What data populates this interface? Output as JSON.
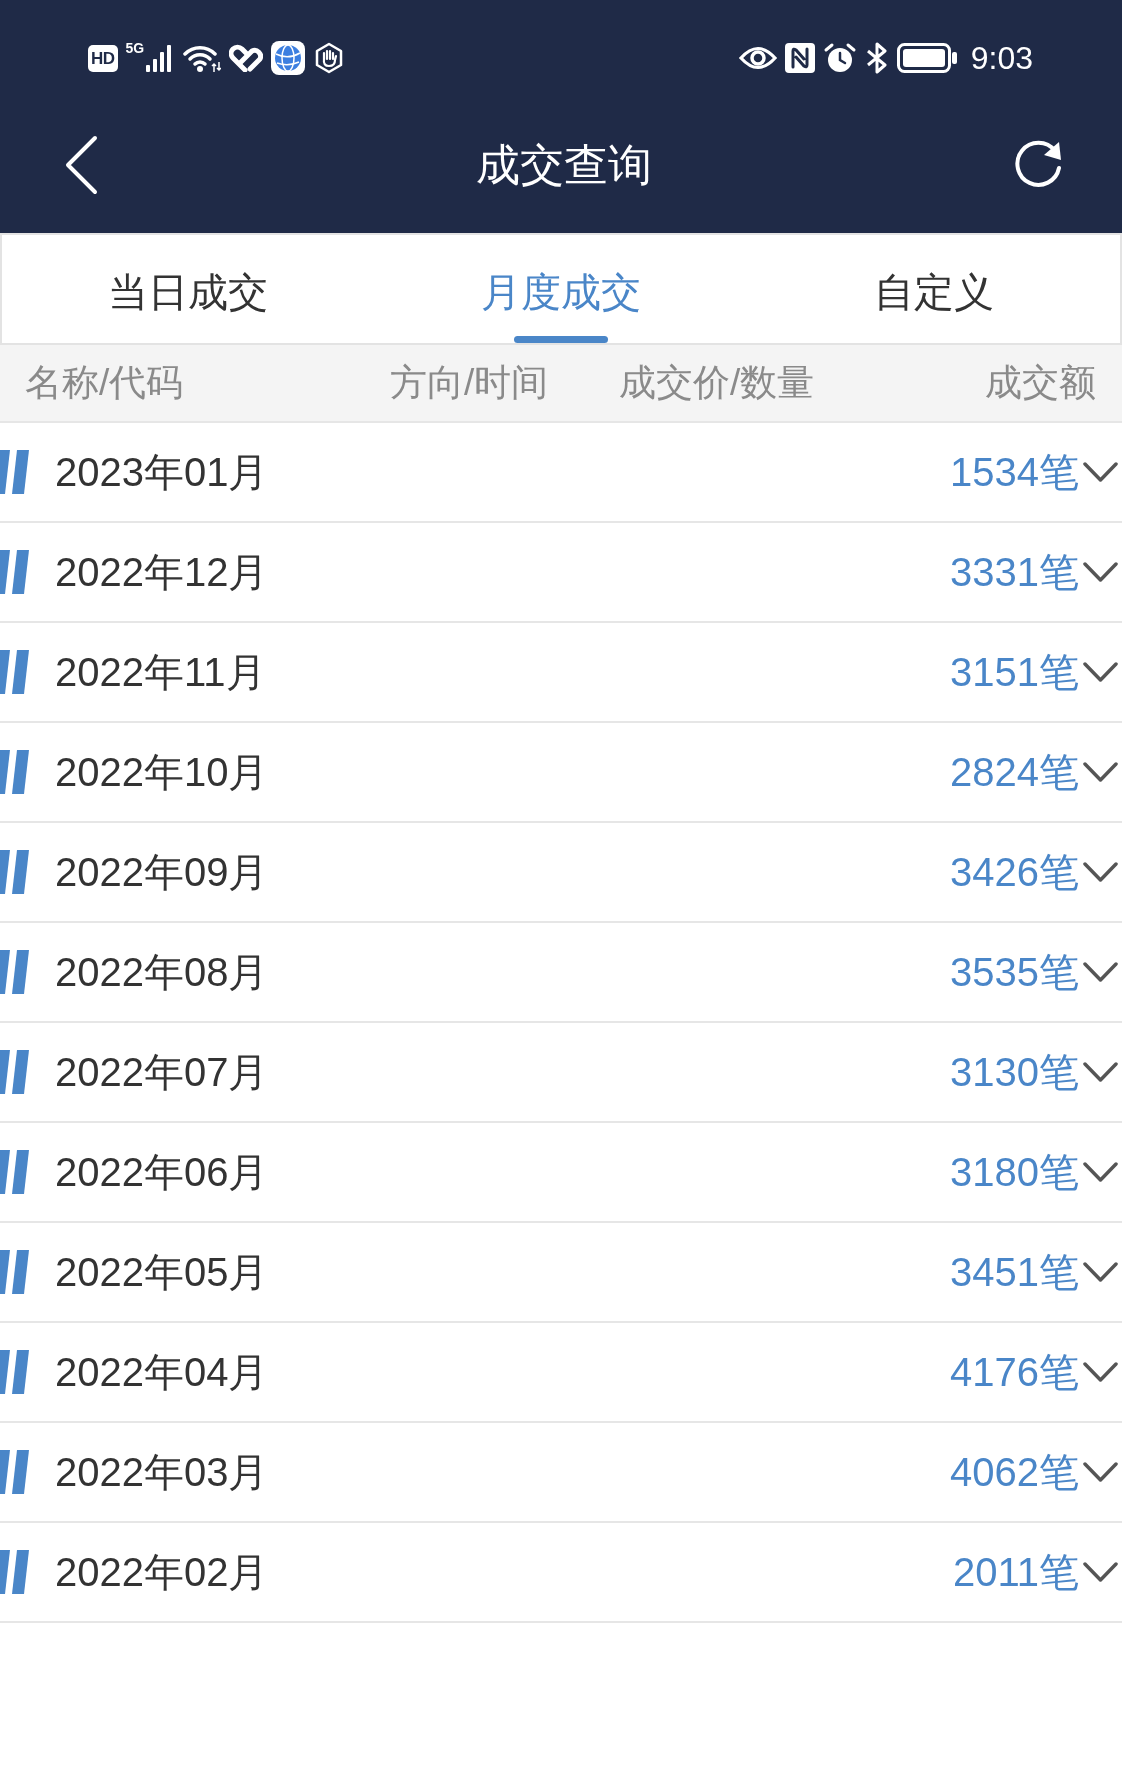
{
  "status_bar": {
    "hd_badge": "HD",
    "network_type": "5G",
    "time": "9:03"
  },
  "header": {
    "title": "成交查询"
  },
  "tabs": [
    {
      "label": "当日成交",
      "selected": false
    },
    {
      "label": "月度成交",
      "selected": true
    },
    {
      "label": "自定义",
      "selected": false
    }
  ],
  "table": {
    "columns": [
      "名称/代码",
      "方向/时间",
      "成交价/数量",
      "成交额"
    ],
    "rows": [
      {
        "month": "2023年01月",
        "count": "1534笔",
        "expanded": false
      },
      {
        "month": "2022年12月",
        "count": "3331笔",
        "expanded": false
      },
      {
        "month": "2022年11月",
        "count": "3151笔",
        "expanded": false
      },
      {
        "month": "2022年10月",
        "count": "2824笔",
        "expanded": false
      },
      {
        "month": "2022年09月",
        "count": "3426笔",
        "expanded": false
      },
      {
        "month": "2022年08月",
        "count": "3535笔",
        "expanded": false
      },
      {
        "month": "2022年07月",
        "count": "3130笔",
        "expanded": false
      },
      {
        "month": "2022年06月",
        "count": "3180笔",
        "expanded": false
      },
      {
        "month": "2022年05月",
        "count": "3451笔",
        "expanded": false
      },
      {
        "month": "2022年04月",
        "count": "4176笔",
        "expanded": false
      },
      {
        "month": "2022年03月",
        "count": "4062笔",
        "expanded": false
      },
      {
        "month": "2022年02月",
        "count": "2011笔",
        "expanded": false
      }
    ]
  }
}
